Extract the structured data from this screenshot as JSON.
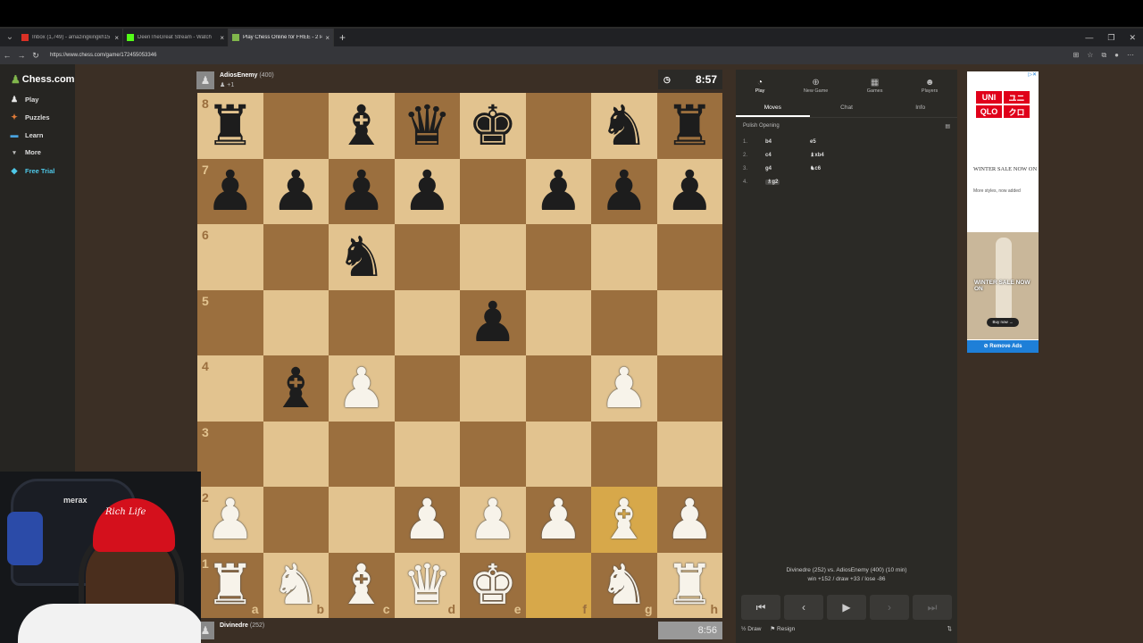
{
  "browser": {
    "tabs": [
      {
        "label": "Inbox (1,749) - amazingkingkh15",
        "active": false
      },
      {
        "label": "DeenTheGreat Stream - Watch",
        "active": false
      },
      {
        "label": "Play Chess Online for FREE - 2 Players",
        "active": true
      }
    ],
    "url": "https://www.chess.com/game/172455053346"
  },
  "sidebar": {
    "logo": "Chess.com",
    "items": [
      {
        "label": "Play",
        "icon": "pawn-icon"
      },
      {
        "label": "Puzzles",
        "icon": "puzzle-icon"
      },
      {
        "label": "Learn",
        "icon": "book-icon"
      },
      {
        "label": "More",
        "icon": "chevron-down-icon"
      },
      {
        "label": "Free Trial",
        "icon": "diamond-icon"
      }
    ]
  },
  "opponent": {
    "name": "AdiosEnemy",
    "rating": "(400)",
    "captured": "+1",
    "clock": "8:57"
  },
  "player": {
    "name": "Divinedre",
    "rating": "(252)",
    "clock": "8:56"
  },
  "board": {
    "ranks": [
      "8",
      "7",
      "6",
      "5",
      "4",
      "3",
      "2",
      "1"
    ],
    "files": [
      "a",
      "b",
      "c",
      "d",
      "e",
      "f",
      "g",
      "h"
    ],
    "position": [
      [
        "bR",
        "",
        "bB",
        "bQ",
        "bK",
        "",
        "bN",
        "bR"
      ],
      [
        "bP",
        "bP",
        "bP",
        "bP",
        "",
        "bP",
        "bP",
        "bP"
      ],
      [
        "",
        "",
        "bN",
        "",
        "",
        "",
        "",
        ""
      ],
      [
        "",
        "",
        "",
        "",
        "bP",
        "",
        "",
        ""
      ],
      [
        "",
        "bB",
        "wP",
        "",
        "",
        "",
        "wP",
        ""
      ],
      [
        "",
        "",
        "",
        "",
        "",
        "",
        "",
        ""
      ],
      [
        "wP",
        "",
        "",
        "wP",
        "wP",
        "wP",
        "wB",
        "wP"
      ],
      [
        "wR",
        "wN",
        "wB",
        "wQ",
        "wK",
        "",
        "wN",
        "wR"
      ]
    ],
    "highlights": [
      "f1",
      "g2"
    ]
  },
  "panel": {
    "top_buttons": [
      {
        "label": "Play",
        "icon": "stopwatch-icon"
      },
      {
        "label": "New Game",
        "icon": "plus-icon"
      },
      {
        "label": "Games",
        "icon": "grid-icon"
      },
      {
        "label": "Players",
        "icon": "users-icon"
      }
    ],
    "tabs": [
      "Moves",
      "Chat",
      "Info"
    ],
    "opening": "Polish Opening",
    "moves": [
      {
        "num": "1.",
        "white": "b4",
        "black": "e5"
      },
      {
        "num": "2.",
        "white": "c4",
        "black": "♝xb4"
      },
      {
        "num": "3.",
        "white": "g4",
        "black": "♞c6"
      },
      {
        "num": "4.",
        "white": "♗g2",
        "black": ""
      }
    ],
    "result_line1": "Divinedre (252) vs. AdiosEnemy (400) (10 min)",
    "result_line2": "win +152 / draw +33 / lose -86",
    "draw_label": "Draw",
    "resign_label": "Resign"
  },
  "ad": {
    "brand": [
      "UNI",
      "QLO",
      "ユニ",
      "クロ"
    ],
    "headline": "WINTER SALE NOW ON",
    "sub": "More styles, now added",
    "image_text": "WINTER SALE NOW ON",
    "shop": "Buy now →",
    "remove": "Remove Ads"
  },
  "webcam": {
    "chair_brand": "merax",
    "cap_text": "Rich Life"
  }
}
